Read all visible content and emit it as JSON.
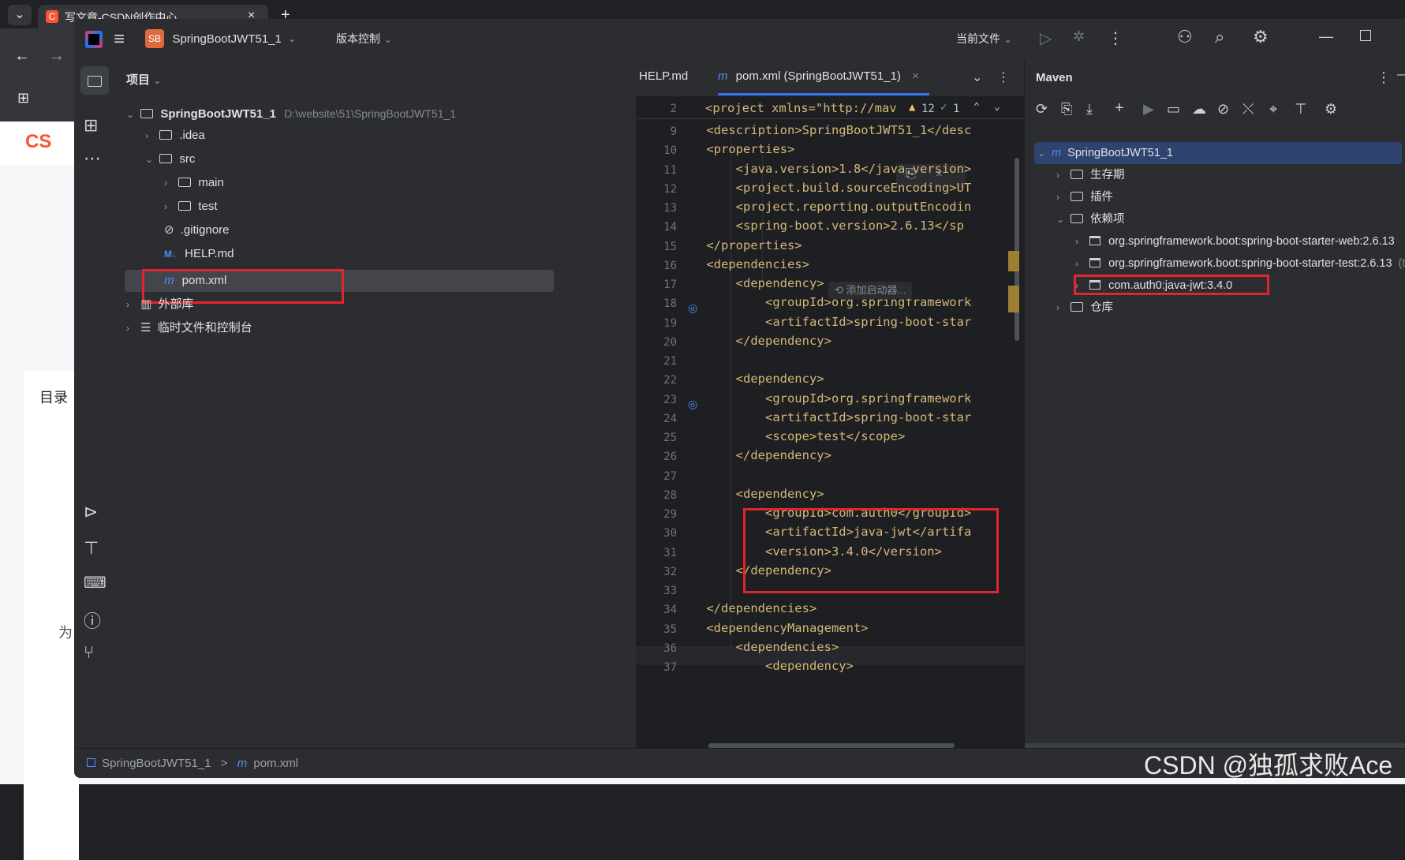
{
  "browser": {
    "tab_title": "写文章-CSDN创作中心",
    "tab_close": "×",
    "new_tab": "+",
    "site_logo": "CS",
    "sidebar_label": "目录",
    "page_partial_text": "为"
  },
  "titlebar": {
    "project_badge": "SB",
    "project_name": "SpringBootJWT51_1",
    "vcs_menu": "版本控制",
    "current_file": "当前文件"
  },
  "project_panel": {
    "header": "项目",
    "root_name": "SpringBootJWT51_1",
    "root_path": "D:\\website\\51\\SpringBootJWT51_1",
    "items": [
      {
        "label": ".idea"
      },
      {
        "label": "src"
      },
      {
        "label": "main"
      },
      {
        "label": "test"
      },
      {
        "label": ".gitignore"
      },
      {
        "label": "HELP.md"
      },
      {
        "label": "pom.xml"
      },
      {
        "label": "外部库"
      },
      {
        "label": "临时文件和控制台"
      }
    ],
    "md_badge": "M↓"
  },
  "editor": {
    "tabs": [
      {
        "label": "HELP.md"
      },
      {
        "label": "pom.xml (SpringBootJWT51_1)"
      }
    ],
    "tab_close": "×",
    "warnings_count": "12",
    "ok_count": "1",
    "inlay_hint": "添加启动器...",
    "sticky_header": "<project xmlns=\"http://mav",
    "lines": [
      {
        "n": "9",
        "code": "    <description>SpringBootJWT51_1</desc"
      },
      {
        "n": "10",
        "code": "    <properties>"
      },
      {
        "n": "11",
        "code": "        <java.version>1.8</java.version>"
      },
      {
        "n": "12",
        "code": "        <project.build.sourceEncoding>UT"
      },
      {
        "n": "13",
        "code": "        <project.reporting.outputEncodin"
      },
      {
        "n": "14",
        "code": "        <spring-boot.version>2.6.13</sp"
      },
      {
        "n": "15",
        "code": "    </properties>"
      },
      {
        "n": "16",
        "code": "    <dependencies>"
      },
      {
        "n": "17",
        "code": "        <dependency>"
      },
      {
        "n": "18",
        "code": "            <groupId>org.springframework"
      },
      {
        "n": "19",
        "code": "            <artifactId>spring-boot-star"
      },
      {
        "n": "20",
        "code": "        </dependency>"
      },
      {
        "n": "21",
        "code": ""
      },
      {
        "n": "22",
        "code": "        <dependency>"
      },
      {
        "n": "23",
        "code": "            <groupId>org.springframework"
      },
      {
        "n": "24",
        "code": "            <artifactId>spring-boot-star"
      },
      {
        "n": "25",
        "code": "            <scope>test</scope>"
      },
      {
        "n": "26",
        "code": "        </dependency>"
      },
      {
        "n": "27",
        "code": ""
      },
      {
        "n": "28",
        "code": "        <dependency>"
      },
      {
        "n": "29",
        "code": "            <groupId>com.auth0</groupId>"
      },
      {
        "n": "30",
        "code": "            <artifactId>java-jwt</artifa"
      },
      {
        "n": "31",
        "code": "            <version>3.4.0</version>"
      },
      {
        "n": "32",
        "code": "        </dependency>"
      },
      {
        "n": "33",
        "code": ""
      },
      {
        "n": "34",
        "code": "    </dependencies>"
      },
      {
        "n": "35",
        "code": "    <dependencyManagement>"
      },
      {
        "n": "36",
        "code": "        <dependencies>"
      },
      {
        "n": "37",
        "code": "            <dependency>"
      }
    ],
    "first_line_no": "2"
  },
  "maven": {
    "title": "Maven",
    "root": "SpringBootJWT51_1",
    "nodes": [
      {
        "label": "生存期"
      },
      {
        "label": "插件"
      },
      {
        "label": "依赖项"
      },
      {
        "label": "org.springframework.boot:spring-boot-starter-web:2.6.13"
      },
      {
        "label": "org.springframework.boot:spring-boot-starter-test:2.6.13"
      },
      {
        "label": "com.auth0:java-jwt:3.4.0"
      },
      {
        "label": "仓库"
      }
    ],
    "test_scope": "(test"
  },
  "statusbar": {
    "crumb_project": "SpringBootJWT51_1",
    "crumb_sep": ">",
    "crumb_file": "pom.xml"
  },
  "watermark": "CSDN @独孤求败Ace"
}
